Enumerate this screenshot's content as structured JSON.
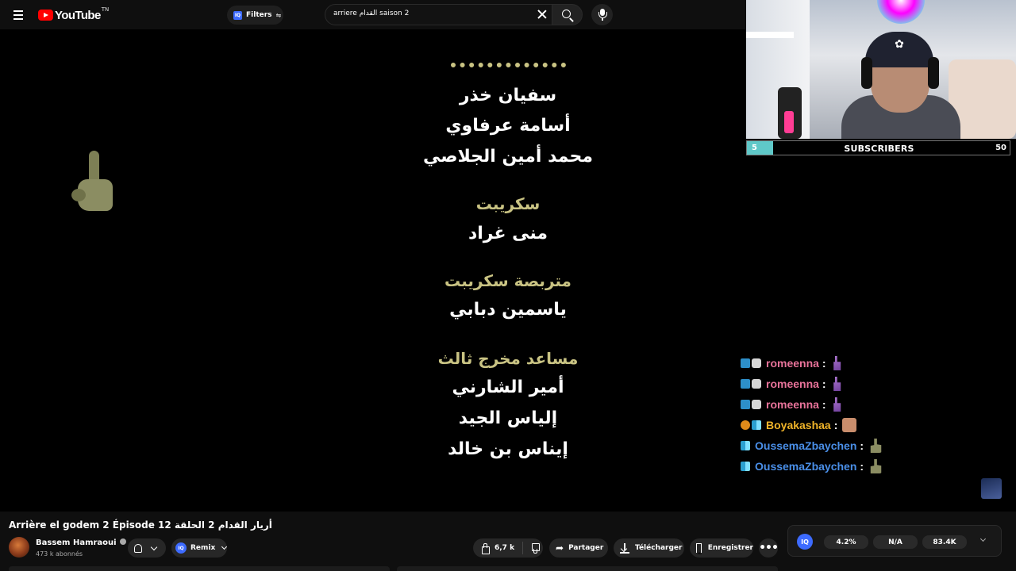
{
  "header": {
    "logo_text": "YouTube",
    "logo_superscript": "TN",
    "filters_label": "Filters",
    "filters_badge": "IQ",
    "search_value": "arriere القدام saison 2"
  },
  "video_overlay": {
    "credits": [
      {
        "type": "name",
        "text": "سفيان خذر"
      },
      {
        "type": "name",
        "text": "أسامة عرفاوي"
      },
      {
        "type": "name",
        "text": "محمد أمين الجلاصي"
      },
      {
        "type": "heading",
        "text": "سكريبت"
      },
      {
        "type": "name",
        "text": "منى غراد"
      },
      {
        "type": "heading",
        "text": "متربصة سكريبت"
      },
      {
        "type": "name",
        "text": "ياسمين دبابي"
      },
      {
        "type": "heading",
        "text": "مساعد مخرج ثالث"
      },
      {
        "type": "name",
        "text": "أمير الشارني"
      },
      {
        "type": "name",
        "text": "إلياس الجيد"
      },
      {
        "type": "name",
        "text": "إيناس بن خالد"
      }
    ],
    "subscriber_goal": {
      "current": "5",
      "label": "SUBSCRIBERS",
      "goal": "50",
      "progress": 0.1,
      "fill_color": "#5fc8c8"
    },
    "chat": [
      {
        "badges": [
          "prime",
          "mod"
        ],
        "user": "romeenna",
        "color": "#e8739a",
        "colon": ":",
        "emote": "hand"
      },
      {
        "badges": [
          "prime",
          "mod"
        ],
        "user": "romeenna",
        "color": "#e8739a",
        "colon": ":",
        "emote": "hand"
      },
      {
        "badges": [
          "prime",
          "mod"
        ],
        "user": "romeenna",
        "color": "#e8739a",
        "colon": ":",
        "emote": "hand"
      },
      {
        "badges": [
          "sub",
          "pattern"
        ],
        "user": "Boyakashaa",
        "color": "#f0b429",
        "colon": ":",
        "emote": "face"
      },
      {
        "badges": [
          "pattern"
        ],
        "user": "OussemaZbaychen",
        "color": "#4a8fe8",
        "colon": ":",
        "emote": "thumb"
      },
      {
        "badges": [
          "pattern"
        ],
        "user": "OussemaZbaychen",
        "color": "#4a8fe8",
        "colon": ":",
        "emote": "thumb"
      }
    ]
  },
  "info": {
    "title": "Arrière el godem 2 Épisode 12 أريار القدام 2 الحلقة",
    "channel_name": "Bassem Hamraoui",
    "subscribers": "473 k abonnés",
    "remix_label": "Remix",
    "remix_badge": "IQ",
    "likes": "6,7 k",
    "share_label": "Partager",
    "download_label": "Télécharger",
    "save_label": "Enregistrer",
    "more_label": "•••"
  },
  "stats": {
    "badge": "IQ",
    "values": [
      "4.2%",
      "N/A",
      "83.4K"
    ]
  }
}
